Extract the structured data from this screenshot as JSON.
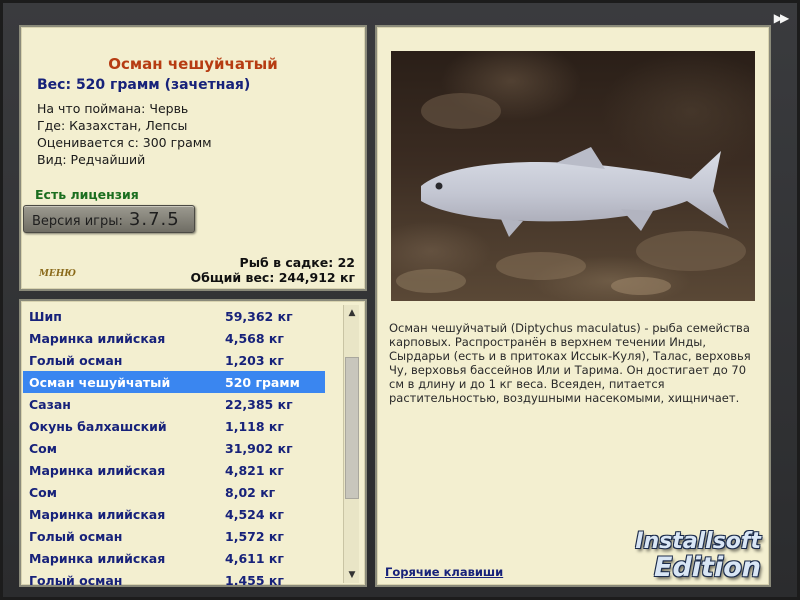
{
  "info": {
    "title": "Осман чешуйчатый",
    "weight_line": "Вес: 520 грамм (зачетная)",
    "lines": [
      "На что поймана: Червь",
      "Где: Казахстан, Лепсы",
      "Оценивается с: 300 грамм",
      "Вид: Редчайший"
    ],
    "license": "Есть лицензия",
    "version_label": "Версия игры:",
    "version_number": "3.7.5",
    "logo": "МЕНЮ",
    "cage_count": "Рыб в садке: 22",
    "total_weight": "Общий вес: 244,912 кг"
  },
  "fish_list": {
    "selected_index": 3,
    "rows": [
      {
        "name": "Шип",
        "weight": "59,362 кг"
      },
      {
        "name": "Маринка илийская",
        "weight": "4,568 кг"
      },
      {
        "name": "Голый осман",
        "weight": "1,203 кг"
      },
      {
        "name": "Осман чешуйчатый",
        "weight": "520 грамм"
      },
      {
        "name": "Сазан",
        "weight": "22,385 кг"
      },
      {
        "name": "Окунь балхашский",
        "weight": "1,118 кг"
      },
      {
        "name": "Сом",
        "weight": "31,902 кг"
      },
      {
        "name": "Маринка илийская",
        "weight": "4,821 кг"
      },
      {
        "name": "Сом",
        "weight": "8,02 кг"
      },
      {
        "name": "Маринка илийская",
        "weight": "4,524 кг"
      },
      {
        "name": "Голый осман",
        "weight": "1,572 кг"
      },
      {
        "name": "Маринка илийская",
        "weight": "4,611 кг"
      },
      {
        "name": "Голый осман",
        "weight": "1,455 кг"
      }
    ]
  },
  "detail": {
    "description": "Осман чешуйчатый (Diptychus maculatus) - рыба семейства карповых. Распространён в верхнем течении Инды, Сырдарьи (есть и в притоках Иссык-Куля), Талас, верховья Чу, верховья бассейнов Или и Тарима. Он достигает до 70 см в длину и до 1 кг веса. Всеяден, питается растительностью, воздушными насекомыми, хищничает.",
    "hotkeys": "Горячие клавиши"
  },
  "branding": {
    "line1": "Installsoft",
    "line2": "Edition"
  },
  "icons": {
    "forward": "fast-forward-icon",
    "scroll_up": "chevron-up-icon",
    "scroll_down": "chevron-down-icon"
  },
  "colors": {
    "title": "#b63c12",
    "accent_blue": "#17227a",
    "license_green": "#1b6e1f",
    "selection": "#3a86f0",
    "panel_bg": "#f3efd0"
  }
}
